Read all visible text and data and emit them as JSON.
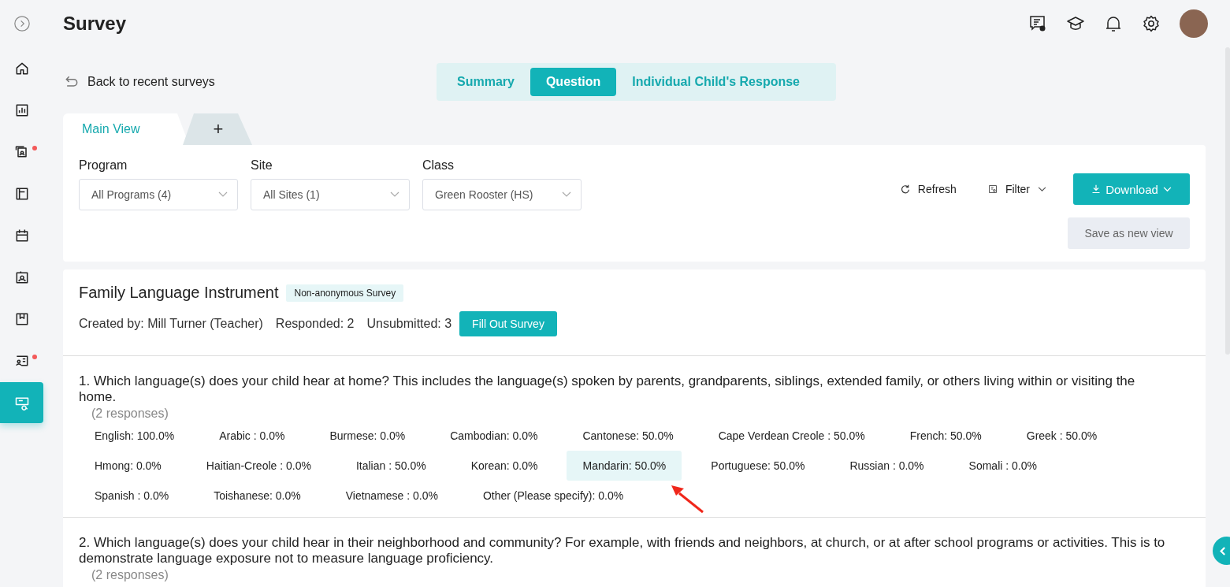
{
  "sidebar": {
    "items": [
      {
        "selected": false,
        "badge": false
      },
      {
        "selected": false,
        "badge": false
      },
      {
        "selected": false,
        "badge": true
      },
      {
        "selected": false,
        "badge": false
      },
      {
        "selected": false,
        "badge": false
      },
      {
        "selected": false,
        "badge": false
      },
      {
        "selected": false,
        "badge": false
      },
      {
        "selected": false,
        "badge": true
      },
      {
        "selected": true,
        "badge": false
      }
    ]
  },
  "page_title": "Survey",
  "back_link": "Back to recent surveys",
  "view_switch": [
    {
      "label": "Summary",
      "selected": false
    },
    {
      "label": "Question",
      "selected": true
    },
    {
      "label": "Individual Child's Response",
      "selected": false
    }
  ],
  "view_tabs": [
    {
      "label": "Main View",
      "selected": true
    },
    {
      "label": "+",
      "selected": false
    }
  ],
  "filters": [
    {
      "label": "Program",
      "value": "All Programs (4)"
    },
    {
      "label": "Site",
      "value": "All Sites (1)"
    },
    {
      "label": "Class",
      "value": "Green Rooster (HS)"
    }
  ],
  "actions": {
    "refresh": "Refresh",
    "filter": "Filter",
    "download": "Download",
    "save_view": "Save as new view"
  },
  "survey": {
    "title": "Family Language Instrument",
    "badge": "Non-anonymous Survey",
    "created_by": "Created by: Mill Turner (Teacher)",
    "responded": "Responded: 2",
    "unsubmitted": "Unsubmitted: 3",
    "fill_button": "Fill Out Survey"
  },
  "questions": [
    {
      "text": "1. Which language(s) does your child hear at home? This includes the language(s) spoken by parents, grandparents, siblings, extended family, or others living within or visiting the home.",
      "responses": "(2 responses)",
      "option_rows": [
        [
          {
            "label": "English: 100.0%",
            "selected": false
          },
          {
            "label": "Arabic : 0.0%",
            "selected": false
          },
          {
            "label": "Burmese: 0.0%",
            "selected": false
          },
          {
            "label": "Cambodian: 0.0%",
            "selected": false
          },
          {
            "label": "Cantonese: 50.0%",
            "selected": false
          },
          {
            "label": "Cape Verdean Creole : 50.0%",
            "selected": false
          },
          {
            "label": "French: 50.0%",
            "selected": false
          },
          {
            "label": "Greek : 50.0%",
            "selected": false
          }
        ],
        [
          {
            "label": "Hmong: 0.0%",
            "selected": false
          },
          {
            "label": "Haitian-Creole : 0.0%",
            "selected": false
          },
          {
            "label": "Italian : 50.0%",
            "selected": false
          },
          {
            "label": "Korean: 0.0%",
            "selected": false
          },
          {
            "label": "Mandarin: 50.0%",
            "selected": true
          },
          {
            "label": "Portuguese: 50.0%",
            "selected": false
          },
          {
            "label": "Russian : 0.0%",
            "selected": false
          },
          {
            "label": "Somali : 0.0%",
            "selected": false
          }
        ],
        [
          {
            "label": "Spanish : 0.0%",
            "selected": false
          },
          {
            "label": "Toishanese: 0.0%",
            "selected": false
          },
          {
            "label": "Vietnamese : 0.0%",
            "selected": false
          },
          {
            "label": "Other (Please specify): 0.0%",
            "selected": false
          }
        ]
      ]
    },
    {
      "text": "2. Which language(s) does your child hear in their neighborhood and community? For example, with friends and neighbors, at church, or at after school programs or activities. This is to demonstrate language exposure not to measure language proficiency.",
      "responses": "(2 responses)"
    }
  ]
}
